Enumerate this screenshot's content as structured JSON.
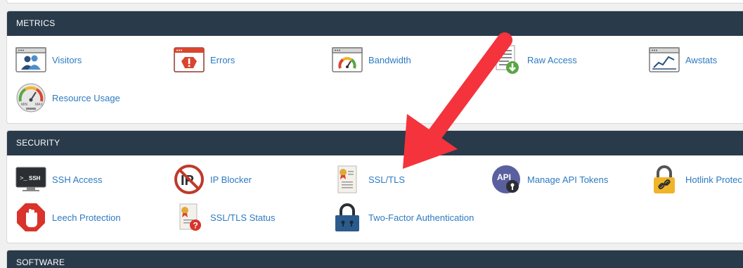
{
  "sections": {
    "metrics": {
      "title": "METRICS",
      "items": [
        {
          "label": "Visitors",
          "icon": "visitors-icon"
        },
        {
          "label": "Errors",
          "icon": "errors-icon"
        },
        {
          "label": "Bandwidth",
          "icon": "bandwidth-icon"
        },
        {
          "label": "Raw Access",
          "icon": "raw-access-icon"
        },
        {
          "label": "Awstats",
          "icon": "awstats-icon"
        },
        {
          "label": "Resource Usage",
          "icon": "resource-usage-icon"
        }
      ]
    },
    "security": {
      "title": "SECURITY",
      "items": [
        {
          "label": "SSH Access",
          "icon": "ssh-terminal-icon"
        },
        {
          "label": "IP Blocker",
          "icon": "ip-blocker-icon"
        },
        {
          "label": "SSL/TLS",
          "icon": "ssl-certificate-icon"
        },
        {
          "label": "Manage API Tokens",
          "icon": "api-tokens-icon"
        },
        {
          "label": "Hotlink Protec",
          "icon": "hotlink-lock-icon"
        },
        {
          "label": "Leech Protection",
          "icon": "leech-hand-icon"
        },
        {
          "label": "SSL/TLS Status",
          "icon": "ssl-status-icon"
        },
        {
          "label": "Two-Factor Authentication",
          "icon": "padlock-icon"
        }
      ]
    },
    "software": {
      "title": "SOFTWARE"
    }
  },
  "icon_texts": {
    "ssh": "SSH",
    "api": "API",
    "gauge_min": "MIN",
    "gauge_max": "MAX"
  },
  "colors": {
    "header_bg": "#293a4a",
    "link": "#2d7ac1",
    "annotation_arrow": "#f4333c"
  }
}
